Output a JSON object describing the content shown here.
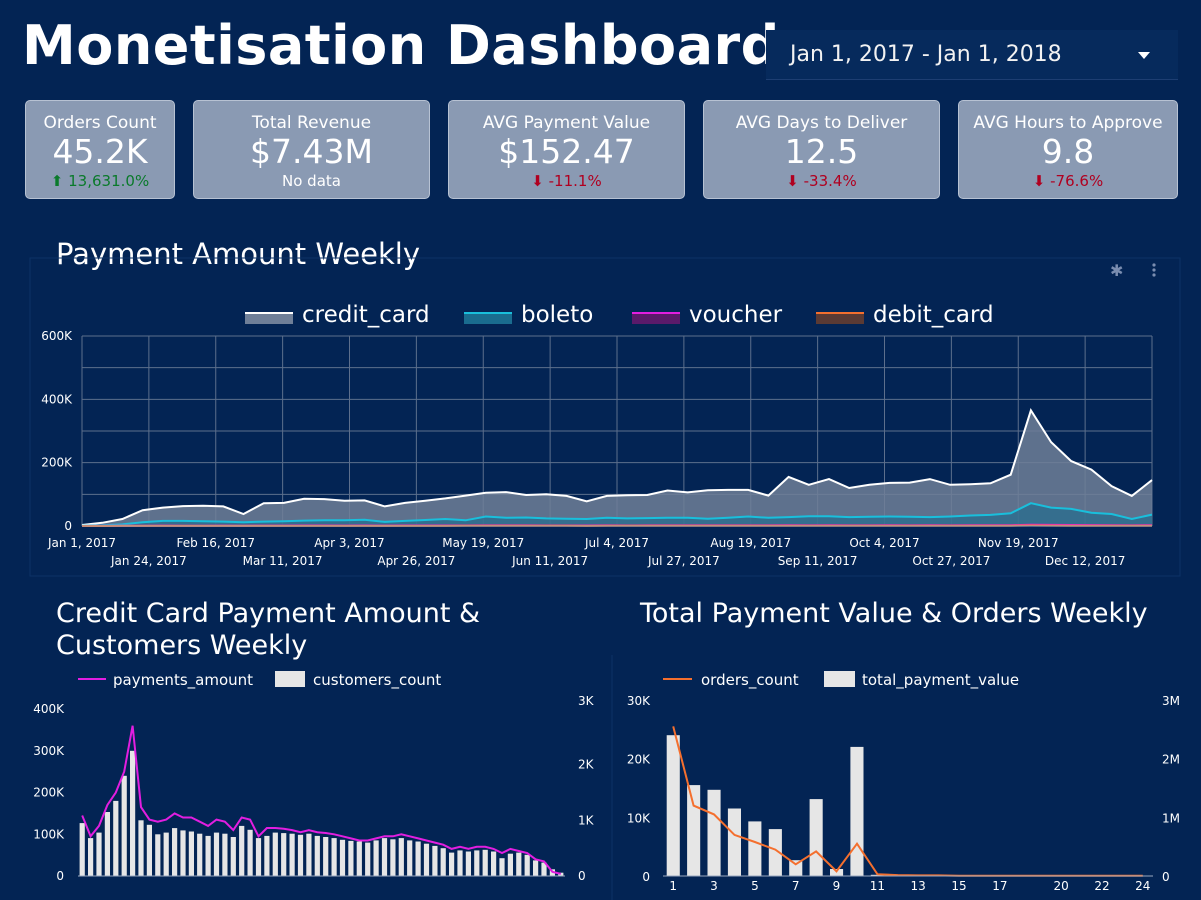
{
  "header": {
    "title": "Monetisation Dashboard",
    "date_range": "Jan 1, 2017 - Jan 1, 2018"
  },
  "kpis": [
    {
      "label": "Orders Count",
      "value": "45.2K",
      "delta": "13,631.0%",
      "direction": "up"
    },
    {
      "label": "Total Revenue",
      "value": "$7.43M",
      "delta": "No data",
      "direction": "none"
    },
    {
      "label": "AVG Payment Value",
      "value": "$152.47",
      "delta": "-11.1%",
      "direction": "down"
    },
    {
      "label": "AVG Days to Deliver",
      "value": "12.5",
      "delta": "-33.4%",
      "direction": "down"
    },
    {
      "label": "AVG Hours to Approve",
      "value": "9.8",
      "delta": "-76.6%",
      "direction": "down"
    }
  ],
  "colors": {
    "background": "#032454",
    "credit_card": "#ffffff",
    "boleto": "#19bfdc",
    "voucher": "#e21ee0",
    "debit_card": "#f46f2e",
    "bars": "#e6e6e6",
    "orders_line": "#f46f2e"
  },
  "chart_data": [
    {
      "type": "area",
      "title": "Payment Amount Weekly",
      "ylim": [
        0,
        600000
      ],
      "yticks": [
        "0",
        "200K",
        "400K",
        "600K"
      ],
      "xticks_row1": [
        "Jan 1, 2017",
        "Feb 16, 2017",
        "Apr 3, 2017",
        "May 19, 2017",
        "Jul 4, 2017",
        "Aug 19, 2017",
        "Oct 4, 2017",
        "Nov 19, 2017"
      ],
      "xticks_row2": [
        "Jan 24, 2017",
        "Mar 11, 2017",
        "Apr 26, 2017",
        "Jun 11, 2017",
        "Jul 27, 2017",
        "Sep 11, 2017",
        "Oct 27, 2017",
        "Dec 12, 2017"
      ],
      "legend_position": "top-center",
      "series": [
        {
          "name": "credit_card",
          "values": [
            3000,
            10000,
            22000,
            50000,
            58000,
            63000,
            64000,
            62000,
            38000,
            72000,
            73000,
            86000,
            85000,
            80000,
            81000,
            62000,
            73000,
            80000,
            87000,
            96000,
            105000,
            107000,
            98000,
            100000,
            95000,
            78000,
            95000,
            97000,
            98000,
            112000,
            106000,
            113000,
            114000,
            114000,
            96000,
            155000,
            130000,
            148000,
            120000,
            130000,
            136000,
            137000,
            148000,
            130000,
            132000,
            135000,
            162000,
            365000,
            265000,
            205000,
            178000,
            126000,
            95000,
            145000
          ]
        },
        {
          "name": "boleto",
          "values": [
            500,
            2000,
            5000,
            12000,
            16000,
            16000,
            15000,
            14000,
            12000,
            14000,
            15000,
            17000,
            18000,
            18000,
            20000,
            13000,
            16000,
            19000,
            22000,
            18000,
            30000,
            26000,
            27000,
            24000,
            23000,
            22000,
            26000,
            24000,
            25000,
            26000,
            26000,
            23000,
            26000,
            30000,
            26000,
            28000,
            31000,
            31000,
            28000,
            29000,
            30000,
            29000,
            28000,
            30000,
            33000,
            35000,
            40000,
            72000,
            58000,
            54000,
            42000,
            38000,
            22000,
            36000
          ]
        },
        {
          "name": "voucher",
          "values": [
            100,
            300,
            500,
            1000,
            1200,
            1100,
            1000,
            1200,
            900,
            1300,
            1300,
            1500,
            1500,
            1400,
            1600,
            1200,
            1500,
            1600,
            1700,
            1700,
            1900,
            1800,
            1800,
            1700,
            1600,
            1500,
            1800,
            1700,
            1800,
            1900,
            1900,
            1800,
            1900,
            2000,
            1800,
            2100,
            2000,
            2100,
            1900,
            2000,
            2100,
            2000,
            2100,
            2000,
            2100,
            2200,
            2400,
            4000,
            3500,
            3000,
            2800,
            2500,
            2000,
            2400
          ]
        },
        {
          "name": "debit_card",
          "values": [
            50,
            100,
            200,
            300,
            300,
            300,
            300,
            300,
            200,
            300,
            300,
            400,
            400,
            400,
            400,
            300,
            400,
            400,
            400,
            500,
            500,
            500,
            500,
            500,
            500,
            400,
            500,
            500,
            500,
            500,
            500,
            500,
            500,
            600,
            500,
            600,
            600,
            600,
            500,
            600,
            600,
            600,
            600,
            600,
            600,
            700,
            800,
            1500,
            1200,
            1000,
            900,
            800,
            600,
            800
          ]
        }
      ]
    },
    {
      "type": "bar",
      "title": "Credit Card Payment Amount & Customers Weekly",
      "left_ylim": [
        0,
        400000
      ],
      "left_yticks": [
        "0",
        "100K",
        "200K",
        "300K",
        "400K"
      ],
      "right_ylim": [
        0,
        3000
      ],
      "right_yticks": [
        "0",
        "1K",
        "2K",
        "3K"
      ],
      "series": [
        {
          "name": "payments_amount",
          "type": "line",
          "axis": "left",
          "values": [
            145000,
            95000,
            120000,
            170000,
            200000,
            250000,
            360000,
            165000,
            135000,
            130000,
            135000,
            150000,
            140000,
            140000,
            130000,
            120000,
            135000,
            130000,
            110000,
            140000,
            135000,
            95000,
            115000,
            115000,
            113000,
            110000,
            105000,
            110000,
            105000,
            103000,
            100000,
            95000,
            90000,
            85000,
            85000,
            90000,
            95000,
            95000,
            100000,
            95000,
            90000,
            85000,
            80000,
            75000,
            65000,
            70000,
            65000,
            70000,
            70000,
            65000,
            55000,
            65000,
            60000,
            55000,
            40000,
            35000,
            10000,
            5000
          ]
        },
        {
          "name": "customers_count",
          "type": "bar",
          "axis": "right",
          "values": [
            950,
            680,
            780,
            1150,
            1350,
            1800,
            2250,
            1000,
            920,
            750,
            780,
            860,
            820,
            800,
            760,
            720,
            780,
            760,
            700,
            900,
            830,
            680,
            720,
            780,
            770,
            760,
            740,
            760,
            720,
            700,
            680,
            650,
            630,
            620,
            600,
            640,
            680,
            660,
            680,
            640,
            620,
            580,
            540,
            500,
            420,
            460,
            440,
            460,
            470,
            440,
            320,
            400,
            420,
            380,
            280,
            240,
            120,
            60
          ]
        }
      ]
    },
    {
      "type": "bar",
      "title": "Total Payment Value & Orders Weekly",
      "categories": [
        "1",
        "2",
        "3",
        "4",
        "5",
        "6",
        "7",
        "8",
        "9",
        "10",
        "11",
        "12",
        "13",
        "14",
        "15",
        "16",
        "17",
        "18",
        "19",
        "20",
        "21",
        "22",
        "23",
        "24"
      ],
      "visible_xticks": [
        "1",
        "3",
        "5",
        "7",
        "9",
        "11",
        "13",
        "15",
        "17",
        "20",
        "22",
        "24"
      ],
      "left_ylim": [
        0,
        30000
      ],
      "left_yticks": [
        "0",
        "10K",
        "20K",
        "30K"
      ],
      "right_ylim": [
        0,
        3000000
      ],
      "right_yticks": [
        "0",
        "1M",
        "2M",
        "3M"
      ],
      "series": [
        {
          "name": "orders_count",
          "type": "line",
          "axis": "left",
          "values": [
            25500,
            12000,
            10500,
            7000,
            5800,
            4500,
            2000,
            4200,
            800,
            5500,
            300,
            150,
            100,
            100,
            50,
            50,
            50,
            50,
            50,
            50,
            50,
            50,
            50,
            50
          ]
        },
        {
          "name": "total_payment_value",
          "type": "bar",
          "axis": "right",
          "values": [
            2400000,
            1550000,
            1470000,
            1150000,
            930000,
            800000,
            270000,
            1310000,
            120000,
            2200000,
            20000,
            10000,
            10000,
            10000,
            0,
            0,
            0,
            0,
            0,
            0,
            0,
            0,
            0,
            0
          ]
        }
      ]
    }
  ]
}
